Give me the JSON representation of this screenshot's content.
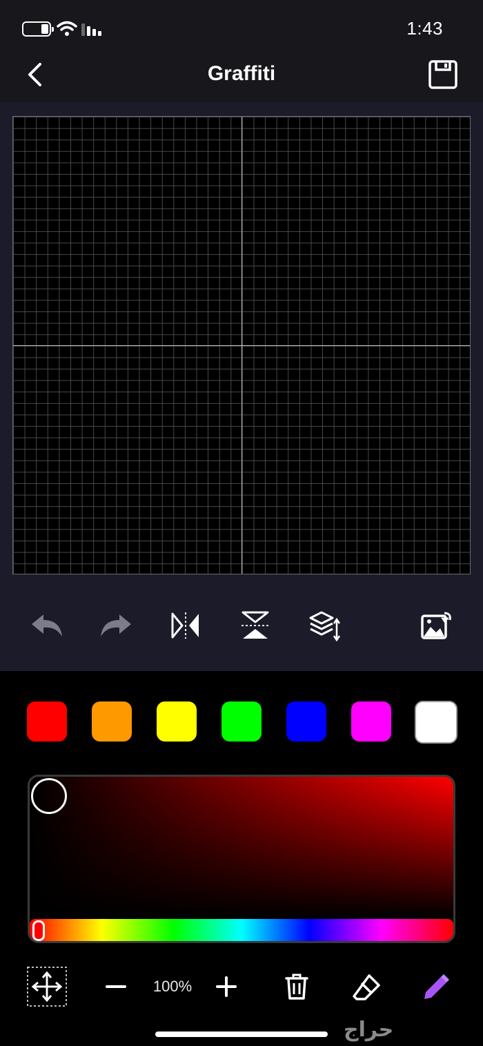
{
  "status_bar": {
    "time": "1:43"
  },
  "nav": {
    "title": "Graffiti",
    "back_icon": "chevron-left-icon",
    "save_icon": "save-icon"
  },
  "tools": [
    {
      "name": "undo",
      "icon": "undo-icon"
    },
    {
      "name": "redo",
      "icon": "redo-icon"
    },
    {
      "name": "mirror-horizontal",
      "icon": "mirror-horizontal-icon"
    },
    {
      "name": "mirror-vertical",
      "icon": "mirror-vertical-icon"
    },
    {
      "name": "layers",
      "icon": "layers-icon"
    },
    {
      "name": "import-image",
      "icon": "image-import-icon"
    }
  ],
  "palette": {
    "colors": [
      "#ff0000",
      "#ff9900",
      "#ffff00",
      "#00ff00",
      "#0000ff",
      "#ff00ff",
      "#ffffff"
    ],
    "selected_index": 6
  },
  "picker": {
    "hue": "#ff0000"
  },
  "bottom_bar": {
    "zoom": "100%"
  },
  "watermark": "حراج"
}
